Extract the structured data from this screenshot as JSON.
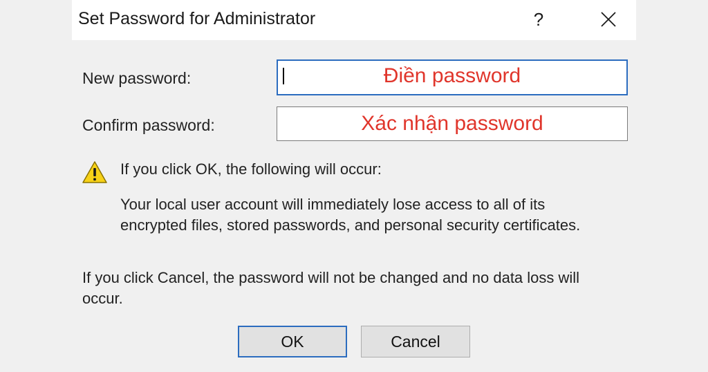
{
  "dialog": {
    "title": "Set Password for Administrator",
    "help_label": "?",
    "new_password": {
      "label": "New password:",
      "value": "",
      "annotation": "Điền password"
    },
    "confirm_password": {
      "label": "Confirm password:",
      "value": "",
      "annotation": "Xác nhận password"
    },
    "warning": {
      "icon": "warning-icon",
      "heading": "If you click OK, the following will occur:",
      "body_line1": "Your local user account will immediately lose access to all of its",
      "body_line2": "encrypted files, stored passwords, and personal security certificates."
    },
    "cancel_note_line1": "If you click Cancel, the password will not be changed and no data loss will",
    "cancel_note_line2": "occur.",
    "buttons": {
      "ok": "OK",
      "cancel": "Cancel"
    }
  },
  "colors": {
    "annotation": "#e0352b",
    "focus_border": "#2b6cbf",
    "warning_yellow": "#f7d117"
  }
}
